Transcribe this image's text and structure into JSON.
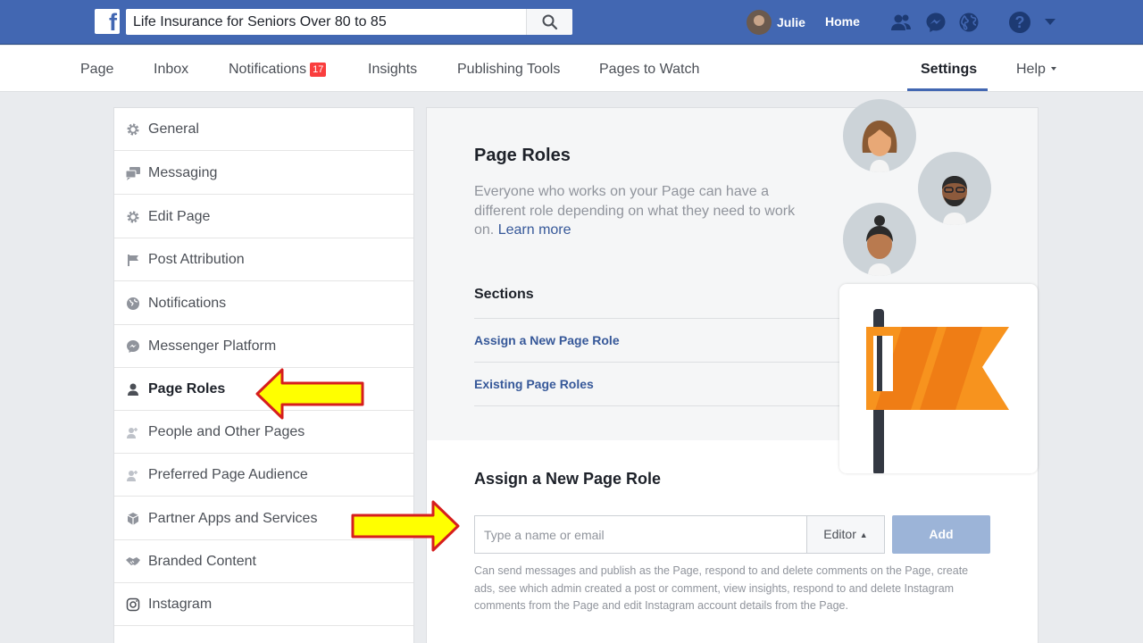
{
  "top_bar": {
    "logo_letter": "f",
    "search_value": "Life Insurance for Seniors Over 80 to 85",
    "user_name": "Julie",
    "home_label": "Home",
    "help_glyph": "?"
  },
  "page_nav": {
    "items": [
      {
        "label": "Page"
      },
      {
        "label": "Inbox"
      },
      {
        "label": "Notifications",
        "badge": "17"
      },
      {
        "label": "Insights"
      },
      {
        "label": "Publishing Tools"
      },
      {
        "label": "Pages to Watch"
      }
    ],
    "settings_label": "Settings",
    "help_label": "Help"
  },
  "sidebar": {
    "items": [
      {
        "label": "General",
        "icon": "gear-icon"
      },
      {
        "label": "Messaging",
        "icon": "speech-bubbles-icon"
      },
      {
        "label": "Edit Page",
        "icon": "gear-icon"
      },
      {
        "label": "Post Attribution",
        "icon": "flag-icon"
      },
      {
        "label": "Notifications",
        "icon": "globe-icon"
      },
      {
        "label": "Messenger Platform",
        "icon": "messenger-icon"
      },
      {
        "label": "Page Roles",
        "icon": "person-icon",
        "active": true
      },
      {
        "label": "People and Other Pages",
        "icon": "people-icon"
      },
      {
        "label": "Preferred Page Audience",
        "icon": "people-icon"
      },
      {
        "label": "Partner Apps and Services",
        "icon": "cube-icon"
      },
      {
        "label": "Branded Content",
        "icon": "handshake-icon"
      },
      {
        "label": "Instagram",
        "icon": "instagram-icon"
      }
    ]
  },
  "main": {
    "title": "Page Roles",
    "description": "Everyone who works on your Page can have a different role depending on what they need to work on.",
    "learn_more": "Learn more",
    "sections_title": "Sections",
    "sections": [
      "Assign a New Page Role",
      "Existing Page Roles"
    ],
    "assign": {
      "title": "Assign a New Page Role",
      "placeholder": "Type a name or email",
      "role_value": "Editor",
      "add_label": "Add",
      "note": "Can send messages and publish as the Page, respond to and delete comments on the Page, create ads, see which admin created a post or comment, view insights, respond to and delete Instagram comments from the Page and edit Instagram account details from the Page."
    }
  },
  "colors": {
    "facebook_blue": "#4267b2",
    "link_blue": "#365899",
    "badge_red": "#fa3e3e",
    "arrow_yellow": "#ffff00",
    "arrow_outline": "#d61e1e",
    "flag_orange": "#f7931e"
  }
}
